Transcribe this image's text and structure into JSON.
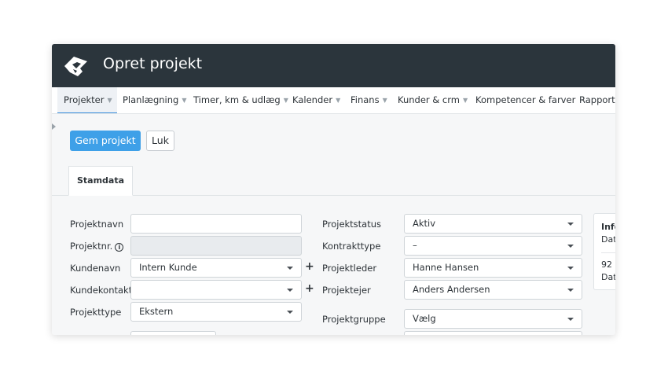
{
  "header": {
    "title": "Opret projekt"
  },
  "nav": {
    "items": [
      {
        "label": "Projekter",
        "chevron": true,
        "active": true
      },
      {
        "label": "Planlægning",
        "chevron": true
      },
      {
        "label": "Timer, km & udlæg",
        "chevron": true
      },
      {
        "label": "Kalender",
        "chevron": true
      },
      {
        "label": "Finans",
        "chevron": true
      },
      {
        "label": "Kunder & crm",
        "chevron": true
      },
      {
        "label": "Kompetencer & farver",
        "chevron": false
      },
      {
        "label": "Rapporte",
        "chevron": false
      }
    ]
  },
  "toolbar": {
    "save_label": "Gem projekt",
    "close_label": "Luk"
  },
  "tabs": [
    {
      "label": "Stamdata",
      "active": true
    }
  ],
  "form": {
    "left": {
      "projektnavn": {
        "label": "Projektnavn",
        "value": ""
      },
      "projektnr": {
        "label": "Projektnr.",
        "value": ""
      },
      "kundenavn": {
        "label": "Kundenavn",
        "value": "Intern Kunde"
      },
      "kundekontakt": {
        "label": "Kundekontakt",
        "value": ""
      },
      "projekttype": {
        "label": "Projekttype",
        "value": "Ekstern"
      }
    },
    "right": {
      "projektstatus": {
        "label": "Projektstatus",
        "value": "Aktiv"
      },
      "kontrakttype": {
        "label": "Kontrakttype",
        "value": "–"
      },
      "projektleder": {
        "label": "Projektleder",
        "value": "Hanne Hansen"
      },
      "projektejer": {
        "label": "Projektejer",
        "value": "Anders Andersen"
      },
      "projektgruppe": {
        "label": "Projektgruppe",
        "value": "Vælg"
      }
    }
  },
  "info_panel": {
    "title": "Info",
    "line1": "Dat",
    "number": "92",
    "line2": "Dat"
  },
  "icons": {
    "logo": "logo-icon",
    "plus": "plus-icon",
    "info": "info-icon",
    "chevron": "chevron-down-icon",
    "caret": "caret-down-icon"
  },
  "colors": {
    "header_bg": "#2b353c",
    "primary": "#3ea0e8",
    "active_tab_border": "#3c8fdd"
  }
}
